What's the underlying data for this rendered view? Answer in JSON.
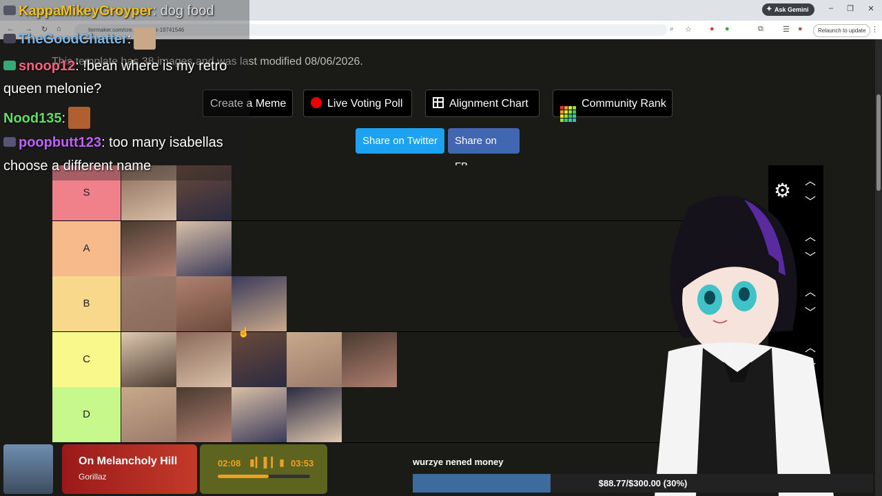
{
  "browser": {
    "gemini_label": "Ask Gemini",
    "url": "tiermaker.com/cre... rape-list-19741546",
    "relaunch_label": "Relaunch to update"
  },
  "page": {
    "info_text": "This template has 38 images and was last modified 08/06/2026.",
    "buttons": {
      "create_meme": "Create a Meme",
      "live_poll": "Live Voting Poll",
      "alignment": "Alignment Chart",
      "community": "Community Rank",
      "share_twitter": "Share on Twitter",
      "share_fb": "Share on FB"
    },
    "tiers": [
      {
        "label": "S",
        "color": "#f0808a",
        "count": 2
      },
      {
        "label": "A",
        "color": "#f7bb8b",
        "count": 2
      },
      {
        "label": "B",
        "color": "#f8d98b",
        "count": 3
      },
      {
        "label": "C",
        "color": "#f8f88b",
        "count": 5
      },
      {
        "label": "D",
        "color": "#c7f88b",
        "count": 4
      }
    ]
  },
  "chat": {
    "lines": [
      {
        "user": "KappaMikeyGroyper",
        "user_color": "#f0c020",
        "message": ": dog food"
      },
      {
        "user": "TheGoodChatter",
        "user_color": "#7fb7e0",
        "message": ":"
      },
      {
        "user": "snoop12",
        "user_color": "#ff6080",
        "message": ": !bean where is my retro"
      },
      {
        "user": "",
        "user_color": "#ffffff",
        "message": "queen melonie?"
      },
      {
        "user": "Nood135",
        "user_color": "#60e060",
        "message": ":"
      },
      {
        "user": "poopbutt123",
        "user_color": "#c060ff",
        "message": ": too many isabellas"
      },
      {
        "user": "",
        "user_color": "#ffffff",
        "message": "choose a different name"
      }
    ]
  },
  "music": {
    "title": "On Melancholy Hill",
    "artist": "Gorillaz",
    "current": "02:08",
    "total": "03:53",
    "progress": 0.55
  },
  "goal": {
    "label": "wurzye nened money",
    "text": "$88.77/$300.00 (30%)",
    "fraction": 0.3
  }
}
